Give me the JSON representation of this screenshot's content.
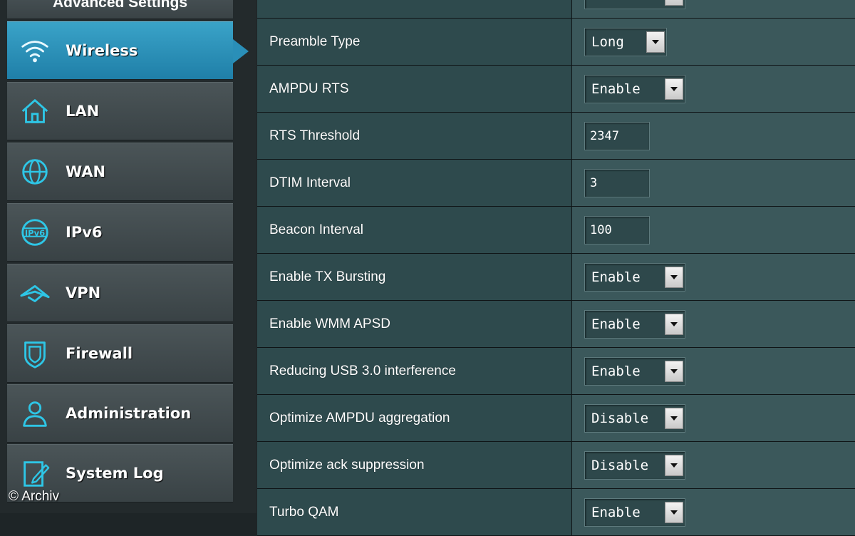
{
  "sidebar": {
    "header": "Advanced Settings",
    "items": [
      {
        "label": "Wireless",
        "icon": "wifi-icon",
        "active": true
      },
      {
        "label": "LAN",
        "icon": "home-icon"
      },
      {
        "label": "WAN",
        "icon": "globe-icon"
      },
      {
        "label": "IPv6",
        "icon": "ipv6-icon"
      },
      {
        "label": "VPN",
        "icon": "vpn-icon"
      },
      {
        "label": "Firewall",
        "icon": "shield-icon"
      },
      {
        "label": "Administration",
        "icon": "user-icon"
      },
      {
        "label": "System Log",
        "icon": "log-icon"
      }
    ]
  },
  "settings": {
    "rows": [
      {
        "label": "",
        "type": "select",
        "value": ""
      },
      {
        "label": "Preamble Type",
        "type": "select",
        "value": "Long"
      },
      {
        "label": "AMPDU RTS",
        "type": "select",
        "value": "Enable"
      },
      {
        "label": "RTS Threshold",
        "type": "text",
        "value": "2347"
      },
      {
        "label": "DTIM Interval",
        "type": "text",
        "value": "3"
      },
      {
        "label": "Beacon Interval",
        "type": "text",
        "value": "100"
      },
      {
        "label": "Enable TX Bursting",
        "type": "select",
        "value": "Enable"
      },
      {
        "label": "Enable WMM APSD",
        "type": "select",
        "value": "Enable"
      },
      {
        "label": "Reducing USB 3.0 interference",
        "type": "select",
        "value": "Enable"
      },
      {
        "label": "Optimize AMPDU aggregation",
        "type": "select",
        "value": "Disable"
      },
      {
        "label": "Optimize ack suppression",
        "type": "select",
        "value": "Disable"
      },
      {
        "label": "Turbo QAM",
        "type": "select",
        "value": "Enable"
      }
    ]
  },
  "watermark": "© Archiv",
  "colors": {
    "active_accent": "#2a8fb8",
    "label_cell": "#2e4a4d",
    "value_cell": "#3b585b"
  }
}
